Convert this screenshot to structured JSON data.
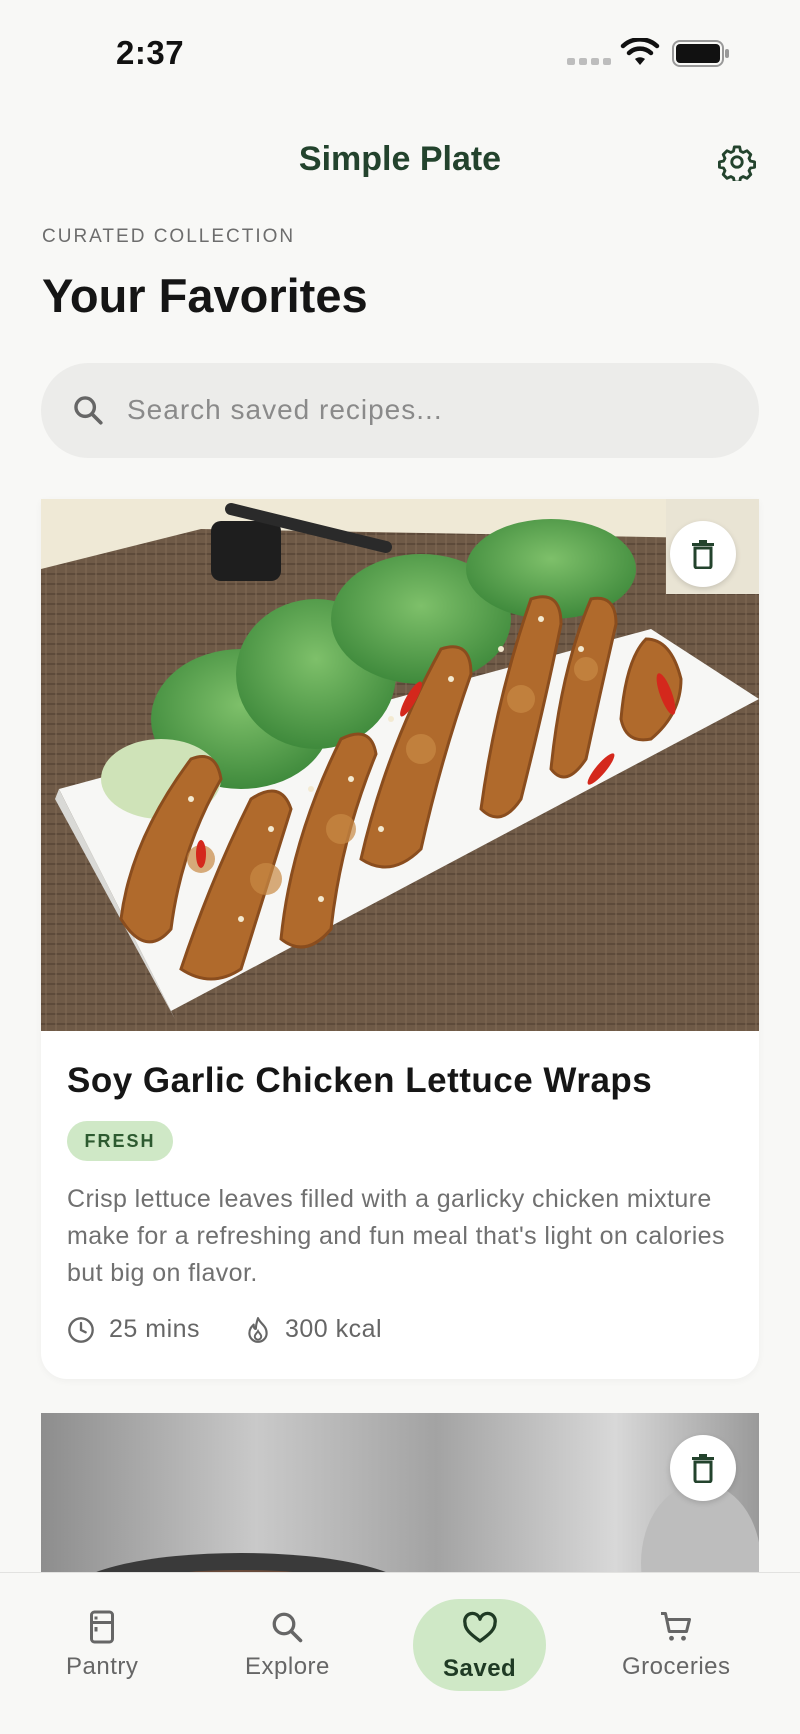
{
  "status_bar": {
    "time": "2:37"
  },
  "header": {
    "app_title": "Simple Plate"
  },
  "page": {
    "eyebrow": "CURATED COLLECTION",
    "title": "Your Favorites"
  },
  "search": {
    "placeholder": "Search saved recipes..."
  },
  "recipes": [
    {
      "title": "Soy Garlic Chicken Lettuce Wraps",
      "tag": "FRESH",
      "description": "Crisp lettuce leaves filled with a garlicky chicken mixture make for a refreshing and fun meal that's light on calories but big on flavor.",
      "time": "25 mins",
      "calories": "300 kcal"
    }
  ],
  "nav": {
    "items": [
      {
        "label": "Pantry",
        "icon": "fridge-icon"
      },
      {
        "label": "Explore",
        "icon": "search-icon"
      },
      {
        "label": "Saved",
        "icon": "heart-icon"
      },
      {
        "label": "Groceries",
        "icon": "cart-icon"
      }
    ],
    "active": "Saved"
  },
  "colors": {
    "accent": "#23432d",
    "tag_bg": "#cfe8c6",
    "background": "#f8f8f6"
  }
}
